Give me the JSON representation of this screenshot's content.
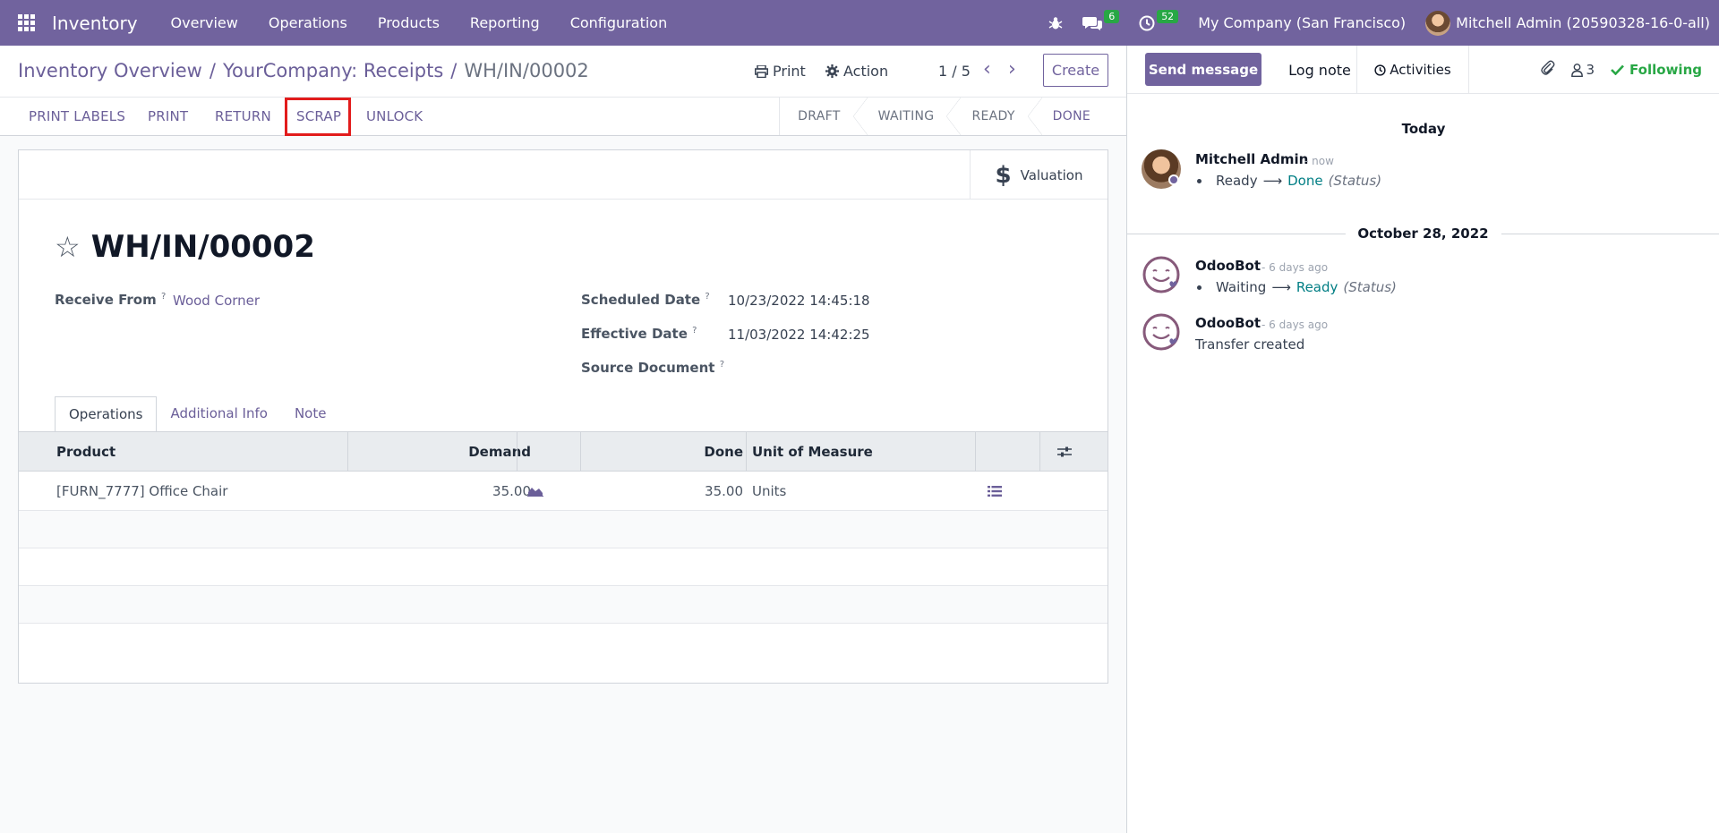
{
  "navbar": {
    "app_name": "Inventory",
    "menu": [
      "Overview",
      "Operations",
      "Products",
      "Reporting",
      "Configuration"
    ],
    "messages_count": "6",
    "activities_count": "52",
    "company": "My Company (San Francisco)",
    "user": "Mitchell Admin (20590328-16-0-all)"
  },
  "breadcrumb": {
    "first": "Inventory Overview",
    "second": "YourCompany: Receipts",
    "current": "WH/IN/00002",
    "separator": "/"
  },
  "control": {
    "print_label": "Print",
    "action_label": "Action",
    "pager": "1 / 5",
    "create_label": "Create"
  },
  "statusbar": {
    "buttons": [
      "PRINT LABELS",
      "PRINT",
      "RETURN",
      "SCRAP",
      "UNLOCK"
    ],
    "stages": [
      "DRAFT",
      "WAITING",
      "READY",
      "DONE"
    ],
    "current_stage": "DONE"
  },
  "form": {
    "valuation_label": "Valuation",
    "title": "WH/IN/00002",
    "receive_from_label": "Receive From",
    "receive_from_value": "Wood Corner",
    "scheduled_date_label": "Scheduled Date",
    "scheduled_date_value": "10/23/2022 14:45:18",
    "effective_date_label": "Effective Date",
    "effective_date_value": "11/03/2022 14:42:25",
    "source_document_label": "Source Document",
    "help_mark": "?",
    "tabs": [
      "Operations",
      "Additional Info",
      "Note"
    ],
    "table": {
      "headers": [
        "Product",
        "Demand",
        "Done",
        "Unit of Measure"
      ],
      "rows": [
        {
          "product": "[FURN_7777] Office Chair",
          "demand": "35.00",
          "done": "35.00",
          "uom": "Units"
        }
      ]
    }
  },
  "chatter": {
    "send_message": "Send message",
    "log_note": "Log note",
    "activities": "Activities",
    "followers_count": "3",
    "following": "Following",
    "sections": [
      {
        "day": "Today",
        "messages": [
          {
            "author": "Mitchell Admin",
            "time": "- now",
            "old": "Ready",
            "new": "Done",
            "field": "(Status)"
          }
        ]
      },
      {
        "day": "October 28, 2022",
        "messages": [
          {
            "author": "OdooBot",
            "time": "- 6 days ago",
            "old": "Waiting",
            "new": "Ready",
            "field": "(Status)"
          },
          {
            "author": "OdooBot",
            "time": "- 6 days ago",
            "body": "Transfer created"
          }
        ]
      }
    ]
  },
  "colors": {
    "brand": "#71639e",
    "badge": "#28a745",
    "highlight": "#e21c1c",
    "link": "#017e84"
  }
}
